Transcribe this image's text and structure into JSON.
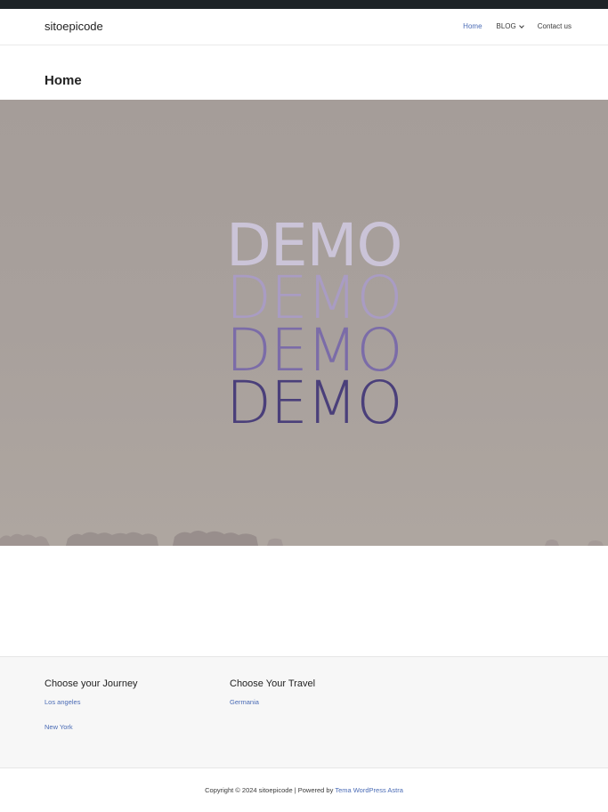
{
  "header": {
    "site_title": "sitoepicode",
    "nav": {
      "home": "Home",
      "blog": "BLOG",
      "contact": "Contact us"
    }
  },
  "main": {
    "page_title": "Home",
    "hero": {
      "lines": [
        "DEMO",
        "DEMO",
        "DEMO",
        "DEMO"
      ],
      "colors": [
        "#cbc4d8",
        "#a99cc3",
        "#7b6ca8",
        "#4a3f7a"
      ],
      "background": "#a8a09c"
    }
  },
  "footer": {
    "widget1": {
      "title": "Choose your Journey",
      "links": [
        "Los angeles",
        "New York"
      ]
    },
    "widget2": {
      "title": "Choose Your Travel",
      "links": [
        "Germania"
      ]
    },
    "copyright_prefix": "Copyright © 2024 sitoepicode | Powered by ",
    "copyright_link": "Tema WordPress Astra"
  },
  "colors": {
    "link": "#4a6bb5",
    "topbar": "#1d2327"
  }
}
